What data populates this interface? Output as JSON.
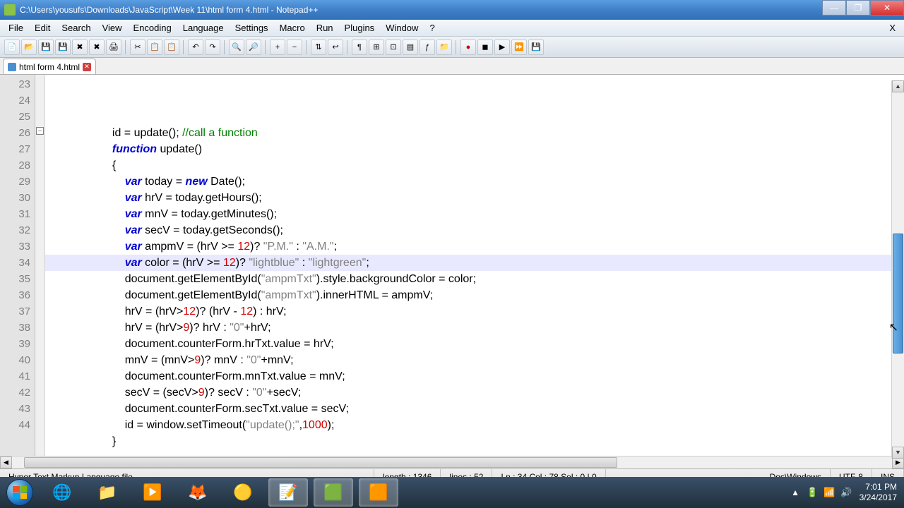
{
  "window": {
    "title": "C:\\Users\\yousufs\\Downloads\\JavaScript\\Week 11\\html form 4.html - Notepad++"
  },
  "menu": {
    "items": [
      "File",
      "Edit",
      "Search",
      "View",
      "Encoding",
      "Language",
      "Settings",
      "Macro",
      "Run",
      "Plugins",
      "Window",
      "?"
    ],
    "x": "X"
  },
  "tab": {
    "label": "html form 4.html"
  },
  "gutter": {
    "start": 23,
    "end": 44
  },
  "code": {
    "l23": "",
    "l24a": "                    id = update(); ",
    "l24b": "//call a function",
    "l25a": "                    ",
    "l25b": "function",
    "l25c": " update()",
    "l26": "                    {",
    "l27a": "                        ",
    "l27v": "var",
    "l27b": " today = ",
    "l27n": "new",
    "l27c": " Date();",
    "l28a": "                        ",
    "l28v": "var",
    "l28b": " hrV = today.getHours();",
    "l29a": "                        ",
    "l29v": "var",
    "l29b": " mnV = today.getMinutes();",
    "l30a": "                        ",
    "l30v": "var",
    "l30b": " secV = today.getSeconds();",
    "l31a": "                        ",
    "l31v": "var",
    "l31b": " ampmV = (hrV >= ",
    "l31n": "12",
    "l31c": ")? ",
    "l31s1": "\"P.M.\"",
    "l31d": " : ",
    "l31s2": "\"A.M.\"",
    "l31e": ";",
    "l32a": "                        ",
    "l32v": "var",
    "l32b": " color = (hrV >= ",
    "l32n": "12",
    "l32c": ")? ",
    "l32s1": "\"lightblue\"",
    "l32d": " : ",
    "l32s2": "\"lightgreen\"",
    "l32e": ";",
    "l33a": "                        document.getElementById(",
    "l33s": "\"ampmTxt\"",
    "l33b": ").style.backgroundColor = color;",
    "l34a": "                        document.getElementById(",
    "l34s": "\"ampmTxt\"",
    "l34b": ").innerHTML = ampmV;",
    "l35a": "                        hrV = (hrV>",
    "l35n1": "12",
    "l35b": ")? (hrV - ",
    "l35n2": "12",
    "l35c": ") : hrV;",
    "l36a": "                        hrV = (hrV>",
    "l36n": "9",
    "l36b": ")? hrV : ",
    "l36s": "\"0\"",
    "l36c": "+hrV;",
    "l37": "                        document.counterForm.hrTxt.value = hrV;",
    "l38a": "                        mnV = (mnV>",
    "l38n": "9",
    "l38b": ")? mnV : ",
    "l38s": "\"0\"",
    "l38c": "+mnV;",
    "l39": "                        document.counterForm.mnTxt.value = mnV;",
    "l40a": "                        secV = (secV>",
    "l40n": "9",
    "l40b": ")? secV : ",
    "l40s": "\"0\"",
    "l40c": "+secV;",
    "l41": "                        document.counterForm.secTxt.value = secV;",
    "l42": "",
    "l43a": "                        id = window.setTimeout(",
    "l43s": "\"update();\"",
    "l43b": ",",
    "l43n": "1000",
    "l43c": ");",
    "l44": "                    }"
  },
  "status": {
    "filetype": "Hyper Text Markup Language file",
    "length": "length : 1346",
    "lines": "lines : 52",
    "pos": "Ln : 34    Col : 78    Sel : 0 | 0",
    "eol": "Dos\\Windows",
    "enc": "UTF-8",
    "mode": "INS"
  },
  "tray": {
    "time": "7:01 PM",
    "date": "3/24/2017"
  }
}
